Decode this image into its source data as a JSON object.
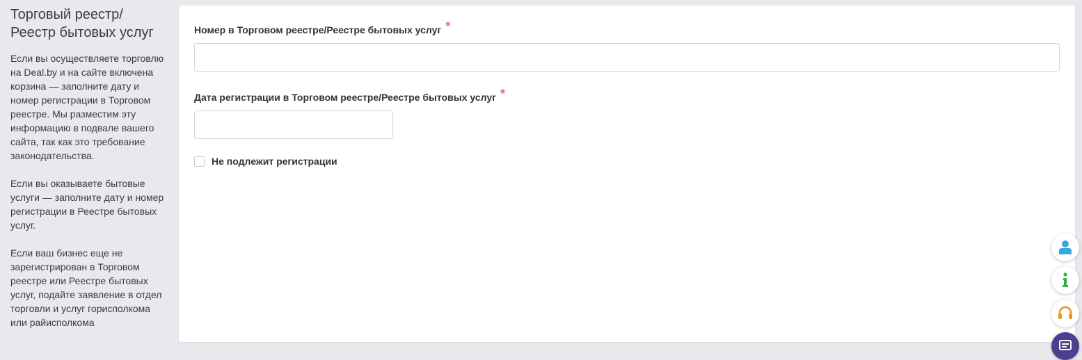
{
  "sidebar": {
    "title": "Торговый реестр/ Реестр бытовых услуг",
    "paragraphs": [
      "Если вы осуществляете торговлю на Deal.by и на сайте включена корзина — заполните дату и номер регистрации в Торговом реестре. Мы разместим эту информацию в подвале вашего сайта, так как это требование законодательства.",
      "Если вы оказываете бытовые услуги — заполните дату и номер регистрации в Реестре бытовых услуг.",
      "Если ваш бизнес еще не зарегистрирован в Торговом реестре или Реестре бытовых услуг, подайте заявление в отдел торговли и услуг горисполкома или райисполкома"
    ]
  },
  "form": {
    "number_label": "Номер в Торговом реестре/Реестре бытовых услуг",
    "number_value": "",
    "date_label": "Дата регистрации в Торговом реестре/Реестре бытовых услуг",
    "date_value": "",
    "required_mark": "*",
    "not_subject_label": "Не подлежит регистрации"
  },
  "floating_buttons": [
    {
      "icon": "user-icon",
      "color": "#3aa5e0"
    },
    {
      "icon": "info-icon",
      "color": "#2fb14a"
    },
    {
      "icon": "headset-icon",
      "color": "#f0932b"
    },
    {
      "icon": "chat-icon",
      "color": "#4b3f8f"
    }
  ]
}
